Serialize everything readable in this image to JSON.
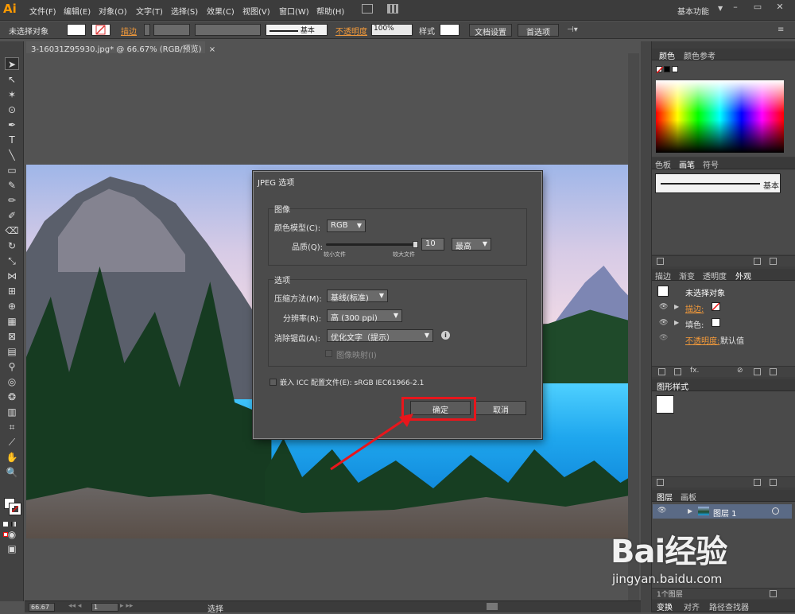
{
  "app": {
    "logo": "Ai",
    "menu": [
      "文件(F)",
      "编辑(E)",
      "对象(O)",
      "文字(T)",
      "选择(S)",
      "效果(C)",
      "视图(V)",
      "窗口(W)",
      "帮助(H)"
    ],
    "workspace": "基本功能",
    "window_controls": [
      "–",
      "▭",
      "✕"
    ]
  },
  "controlbar": {
    "no_selection": "未选择对象",
    "stroke_label": "描边",
    "stroke_style": "基本",
    "opacity_label": "不透明度",
    "opacity_value": "100%",
    "style_label": "样式",
    "doc_settings": "文档设置",
    "preferences": "首选项"
  },
  "document": {
    "tab_title": "3-16031Z95930.jpg* @ 66.67% (RGB/预览)",
    "tab_close": "×"
  },
  "dialog": {
    "title": "JPEG 选项",
    "image_section": "图像",
    "color_model_label": "颜色模型(C):",
    "color_model_value": "RGB",
    "quality_label": "品质(Q):",
    "quality_value": "10",
    "quality_preset": "最高",
    "quality_small": "较小文件",
    "quality_large": "较大文件",
    "quality_fraction": 0.98,
    "options_section": "选项",
    "compression_label": "压缩方法(M):",
    "compression_value": "基线(标准)",
    "resolution_label": "分辨率(R):",
    "resolution_value": "高 (300 ppi)",
    "antialias_label": "消除锯齿(A):",
    "antialias_value": "优化文字（提示）",
    "imagemap_label": "图像映射(I)",
    "embed_icc_label": "嵌入 ICC 配置文件(E): sRGB IEC61966-2.1",
    "ok": "确定",
    "cancel": "取消"
  },
  "panels": {
    "color_tabs": [
      "颜色",
      "颜色参考"
    ],
    "stroke_tabs": [
      "色板",
      "画笔",
      "符号"
    ],
    "brush_name": "基本",
    "appearance_tabs": [
      "描边",
      "渐变",
      "透明度",
      "外观"
    ],
    "appearance_title": "未选择对象",
    "appearance_stroke": "描边:",
    "appearance_fill": "填色:",
    "appearance_opacity": "不透明度:",
    "appearance_opacity_value": "默认值",
    "graphic_styles_tab": "图形样式",
    "layers_tabs": [
      "图层",
      "画板"
    ],
    "layer_name": "图层 1",
    "layers_count": "1个图层",
    "bottom_tabs": [
      "变换",
      "对齐",
      "路径查找器"
    ]
  },
  "statusbar": {
    "zoom": "66.67",
    "artboard": "1",
    "tool": "选择"
  },
  "watermark": {
    "brand": "Bai经验",
    "url": "jingyan.baidu.com"
  },
  "colors": {
    "highlight": "#e8161c",
    "accent_orange": "#f39a3a"
  }
}
